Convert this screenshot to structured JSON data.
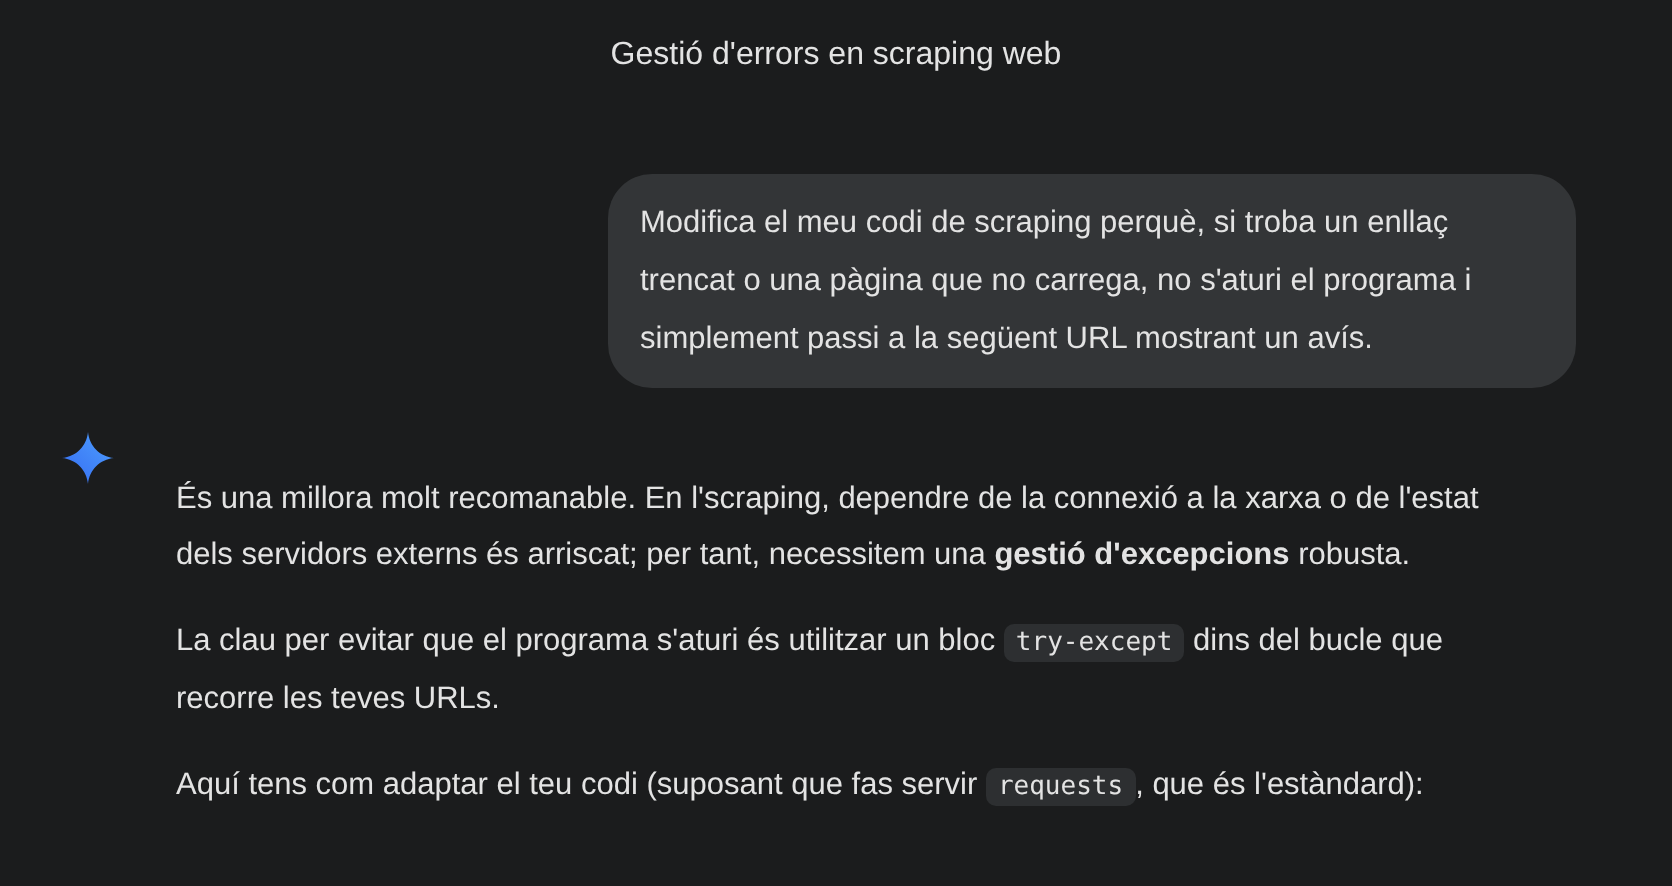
{
  "title": "Gestió d'errors en scraping web",
  "user_message": "Modifica el meu codi de scraping perquè, si troba un enllaç trencat o una pàgina que no carrega, no s'aturi el programa i simplement passi a la següent URL mostrant un avís.",
  "response": {
    "paragraphs": [
      [
        {
          "kind": "text",
          "text": "És una millora molt recomanable. En l'scraping, dependre de la connexió a la xarxa o de l'estat dels servidors externs és arriscat; per tant, necessitem una **gestió d'excepcions** robusta."
        }
      ],
      [
        {
          "kind": "text",
          "text": "La clau per evitar que el programa s'aturi és utilitzar un bloc "
        },
        {
          "kind": "code",
          "text": "try-except"
        },
        {
          "kind": "text",
          "text": " dins del bucle que recorre les teves URLs."
        }
      ],
      [
        {
          "kind": "text",
          "text": "Aquí tens com adaptar el teu codi (suposant que fas servir "
        },
        {
          "kind": "code",
          "text": "requests"
        },
        {
          "kind": "text",
          "text": ", que és l'estàndard):"
        }
      ]
    ]
  }
}
